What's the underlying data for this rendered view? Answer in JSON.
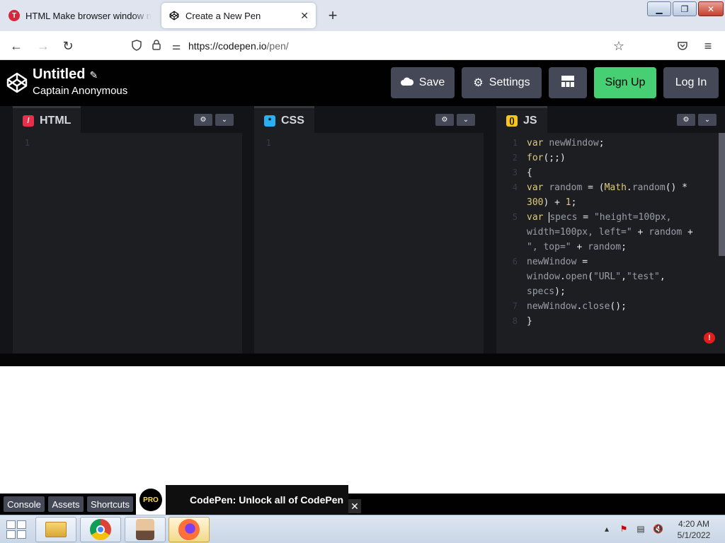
{
  "browser": {
    "tabs": [
      {
        "title": "HTML Make browser window no",
        "active": false,
        "icon": "t-favicon-icon"
      },
      {
        "title": "Create a New Pen",
        "active": true,
        "icon": "codepen-favicon-icon"
      }
    ],
    "new_tab_label": "+",
    "url_host": "https://codepen.io",
    "url_path": "/pen/"
  },
  "header": {
    "title": "Untitled",
    "author": "Captain Anonymous",
    "save_label": "Save",
    "settings_label": "Settings",
    "signup_label": "Sign Up",
    "login_label": "Log In"
  },
  "panes": {
    "html": {
      "label": "HTML",
      "line_numbers": [
        "1"
      ]
    },
    "css": {
      "label": "CSS",
      "line_numbers": [
        "1"
      ]
    },
    "js": {
      "label": "JS",
      "line_numbers": [
        "1",
        "2",
        "3",
        "4",
        "5",
        "6",
        "7",
        "8"
      ]
    }
  },
  "js_code": {
    "l1_a": "var ",
    "l1_b": "newWindow",
    "l1_c": ";",
    "l2_a": "for",
    "l2_b": "(;;)",
    "l3": "{",
    "l4_a": "var ",
    "l4_b": "random",
    "l4_c": " = (",
    "l4_d": "Math",
    "l4_e": ".",
    "l4_f": "random",
    "l4_g": "() *",
    "l4w_a": "300",
    "l4w_b": ") + ",
    "l4w_c": "1",
    "l4w_d": ";",
    "l5_a": "var ",
    "l5_b": "specs",
    "l5_c": " = ",
    "l5_d": "\"height=100px,",
    "l5w1_a": "width=100px, left=\"",
    "l5w1_b": " + ",
    "l5w1_c": "random",
    "l5w1_d": " +",
    "l5w2_a": "\", top=\"",
    "l5w2_b": " + ",
    "l5w2_c": "random",
    "l5w2_d": ";",
    "l6_a": "newWindow",
    "l6_b": " =",
    "l6w1_a": "window",
    "l6w1_b": ".",
    "l6w1_c": "open",
    "l6w1_d": "(",
    "l6w1_e": "\"URL\"",
    "l6w1_f": ",",
    "l6w1_g": "\"test\"",
    "l6w1_h": ",",
    "l6w2_a": "specs",
    "l6w2_b": ");",
    "l7_a": "newWindow",
    "l7_b": ".",
    "l7_c": "close",
    "l7_d": "();",
    "l8": "}"
  },
  "footer": {
    "console_label": "Console",
    "assets_label": "Assets",
    "shortcuts_label": "Shortcuts"
  },
  "promo": {
    "badge": "PRO",
    "text": "CodePen: Unlock all of CodePen"
  },
  "taskbar": {
    "time": "4:20 AM",
    "date": "5/1/2022"
  },
  "colors": {
    "signup": "#47cf73",
    "button_bg": "#444857",
    "editor_bg": "#1d1e22",
    "html_icon": "#e8304a",
    "css_icon": "#2ab0f0",
    "js_icon": "#f7c51b"
  }
}
